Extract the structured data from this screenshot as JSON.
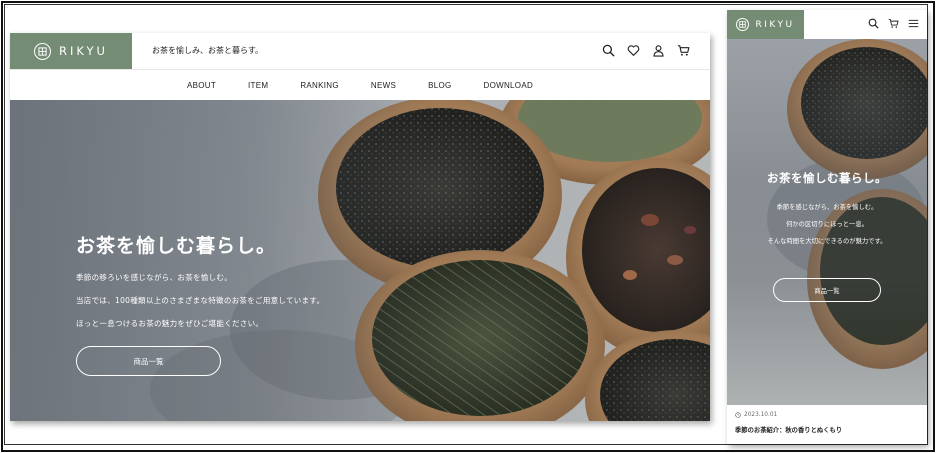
{
  "brand": {
    "name": "RIKYU",
    "color": "#758c74"
  },
  "desktop": {
    "tagline": "お茶を愉しみ、お茶と暮らす。",
    "icons": [
      "search-icon",
      "heart-icon",
      "user-icon",
      "cart-icon"
    ],
    "nav": [
      "ABOUT",
      "ITEM",
      "RANKING",
      "NEWS",
      "BLOG",
      "DOWNLOAD"
    ],
    "hero": {
      "title": "お茶を愉しむ暮らし。",
      "lines": [
        "季節の移ろいを感じながら、お茶を愉しむ。",
        "当店では、100種類以上のさまざまな特徴のお茶をご用意しています。",
        "ほっと一息つけるお茶の魅力をぜひご堪能ください。"
      ],
      "button": "商品一覧"
    }
  },
  "mobile": {
    "icons": [
      "search-icon",
      "cart-icon",
      "menu-icon"
    ],
    "hero": {
      "title": "お茶を愉しむ暮らし。",
      "lines": [
        "季節を感じながら、お茶を愉しむ。",
        "何かの区切りにほっと一息。",
        "そんな時間を大切にできるのが魅力です。"
      ],
      "button": "商品一覧"
    },
    "news": {
      "date": "2023.10.01",
      "title": "季節のお茶紹介：秋の香りとぬくもり"
    }
  }
}
